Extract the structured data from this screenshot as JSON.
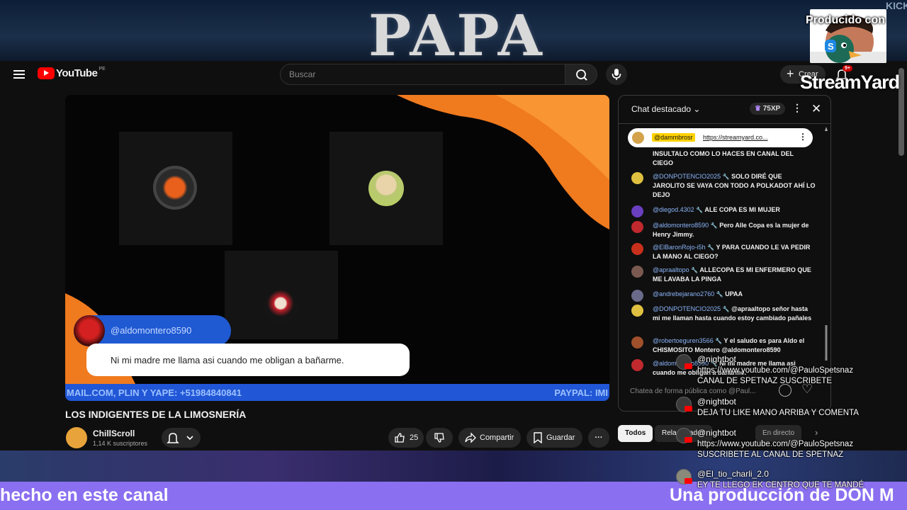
{
  "banner": {
    "title": "PAPA",
    "corner_text": "KICK"
  },
  "overlay": {
    "producido": "Producido con",
    "brand": "StreamYard"
  },
  "header": {
    "logo_text": "YouTube",
    "country": "PE",
    "search_placeholder": "Buscar",
    "create_label": "Crear",
    "notifications_badge": "9+"
  },
  "video": {
    "speaker_name": "@aldomontero8590",
    "speaker_message": "Ni mi madre me llama asi cuando me obligan a bañarme.",
    "ticker_left": "MAIL.COM, PLIN Y YAPE: +51984840841",
    "ticker_right": "PAYPAL: IMI",
    "title": "LOS INDIGENTES DE LA LIMOSNERÍA"
  },
  "channel": {
    "name": "ChillScroll",
    "subs": "1,14 K suscriptores"
  },
  "actions": {
    "likes": "25",
    "share": "Compartir",
    "save": "Guardar",
    "more": "···"
  },
  "chat": {
    "header_title": "Chat destacado",
    "xp": "75XP",
    "pinned": {
      "user": "@dammbrosr",
      "link": "https://streamyard.co..."
    },
    "messages": [
      {
        "user": "",
        "text": "INSULTALO COMO LO HACES EN CANAL DEL CIEGO",
        "color": ""
      },
      {
        "user": "@DONPOTENCIO2025",
        "text": "SOLO DIRÉ QUE JAROLITO SE VAYA CON TODO A POLKADOT AHÍ LO DEJO",
        "color": "#e0c040"
      },
      {
        "user": "@diegod.4302",
        "text": "ALE COPA ES MI MUJER",
        "color": "#6a3fc0"
      },
      {
        "user": "@aldomontero8590",
        "text": "Pero Alle Copa es la mujer de Henry Jimmy.",
        "color": "#c0292e"
      },
      {
        "user": "@ElBaronRojo-i5h",
        "text": "Y PARA CUANDO LE VA PEDIR LA MANO AL CIEGO?",
        "color": "#c8301c"
      },
      {
        "user": "@apraaltopo",
        "text": "ALLECOPA ES MI ENFERMERO QUE ME LAVABA LA PINGA",
        "color": "#7a5a50"
      },
      {
        "user": "@andrebejarano2760",
        "text": "UPAA",
        "color": "#6a6a8a"
      },
      {
        "user": "@DONPOTENCIO2025",
        "text": "@apraaltopo señor hasta mi me llaman hasta cuando estoy cambiado pañales",
        "color": "#e0c040"
      },
      {
        "user": "@robertoeguren3566",
        "text": "Y el saludo es para Aldo el CHISMOSITO Montero @aldomontero8590",
        "color": "#a0502a"
      },
      {
        "user": "@aldomontero8590",
        "text": "Ni mi madre me llama asi cuando me obligan a bañarme.",
        "color": "#c0292e"
      }
    ],
    "input_placeholder": "Chatea de forma pública como @Paul..."
  },
  "chips": {
    "all": "Todos",
    "related": "Relacionados",
    "live": "En directo"
  },
  "nightbot": [
    {
      "name": "@nightbot",
      "text": "https://www.youtube.com/@PauloSpetsnaz CANAL DE SPETNAZ SUSCRIBETE"
    },
    {
      "name": "@nightbot",
      "text": "DEJA TU LIKE MANO ARRIBA Y COMENTA"
    },
    {
      "name": "@nightbot",
      "text": "https://www.youtube.com/@PauloSpetsnaz SUSCRIBETE AL CANAL DE SPETNAZ"
    },
    {
      "name": "@El_tio_charli_2.0",
      "text": "EY TE LLEGO EK CENTRO QUE TE MANDÉ"
    }
  ],
  "bottom": {
    "left_text": "hecho en este canal",
    "right_text": "Una producción de DON M"
  },
  "colors": {
    "ticker": "#2157d6",
    "bottom_bar": "#8a6ff0",
    "youtube_red": "#ff0000"
  }
}
